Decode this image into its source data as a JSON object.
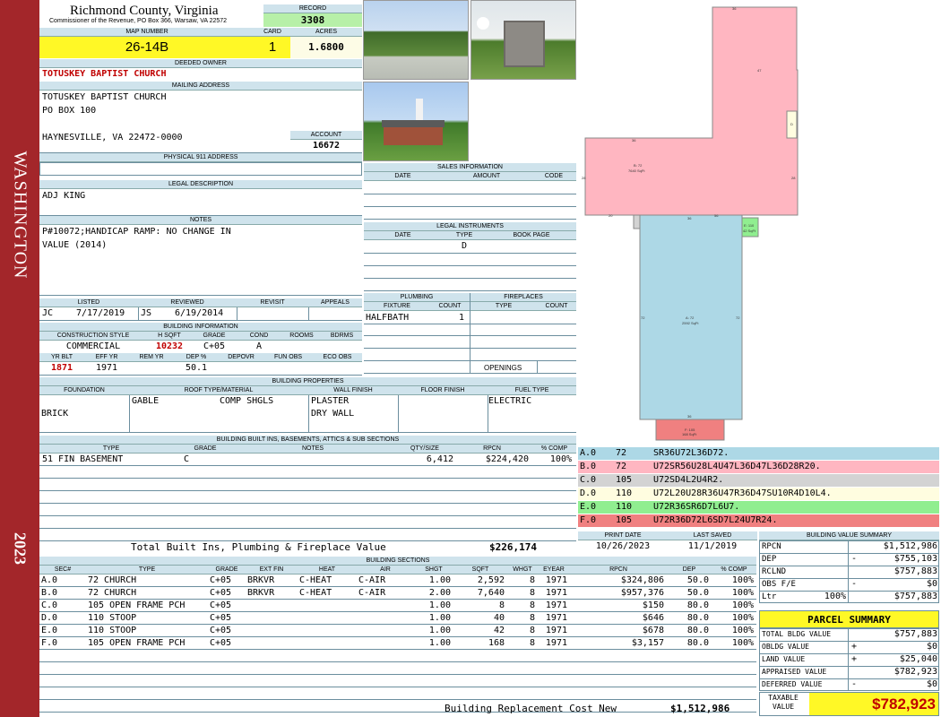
{
  "side": {
    "district": "WASHINGTON",
    "year": "2023"
  },
  "county": {
    "title": "Richmond County, Virginia",
    "subtitle": "Commissioner of the Revenue, PO Box 366, Warsaw, VA 22572"
  },
  "record": {
    "label": "RECORD",
    "value": "3308"
  },
  "map": {
    "label": "MAP NUMBER",
    "value": "26-14B"
  },
  "card": {
    "label": "CARD",
    "value": "1"
  },
  "acres": {
    "label": "ACRES",
    "value": "1.6800"
  },
  "owner": {
    "label": "DEEDED OWNER",
    "value": "TOTUSKEY BAPTIST CHURCH"
  },
  "mailing": {
    "label": "MAILING ADDRESS",
    "line1": "TOTUSKEY BAPTIST CHURCH",
    "line2": "PO BOX 100",
    "line3": "HAYNESVILLE, VA 22472-0000"
  },
  "account": {
    "label": "ACCOUNT",
    "value": "16672"
  },
  "physical": {
    "label": "PHYSICAL 911 ADDRESS"
  },
  "legal": {
    "label": "LEGAL DESCRIPTION",
    "value": "ADJ KING"
  },
  "notes": {
    "label": "NOTES",
    "line1": "P#10072;HANDICAP RAMP: NO CHANGE IN",
    "line2": "VALUE (2014)"
  },
  "listed": {
    "label": "LISTED",
    "by": "JC",
    "date": "7/17/2019"
  },
  "reviewed": {
    "label": "REVIEWED",
    "by": "JS",
    "date": "6/19/2014"
  },
  "revisit": {
    "label": "REVISIT"
  },
  "appeals": {
    "label": "APPEALS"
  },
  "bldginfo": {
    "label": "BUILDING INFORMATION",
    "h_style": "CONSTRUCTION STYLE",
    "h_sqft": "H SQFT",
    "h_grade": "GRADE",
    "h_cond": "COND",
    "h_rooms": "ROOMS",
    "h_bdrms": "BDRMS",
    "style": "COMMERCIAL",
    "sqft": "10232",
    "grade": "C+05",
    "cond": "A",
    "h_yrblt": "YR BLT",
    "h_effyr": "EFF YR",
    "h_remyr": "REM YR",
    "h_dep": "DEP %",
    "h_depovr": "DEPOVR",
    "h_funobs": "FUN OBS",
    "h_ecoobs": "ECO OBS",
    "yrblt": "1871",
    "effyr": "1971",
    "dep": "50.1"
  },
  "sales": {
    "label": "SALES INFORMATION",
    "h_date": "DATE",
    "h_amount": "AMOUNT",
    "h_code": "CODE"
  },
  "instruments": {
    "label": "LEGAL INSTRUMENTS",
    "h_date": "DATE",
    "h_type": "TYPE",
    "h_bookpage": "BOOK PAGE",
    "type1": "D"
  },
  "plumbing": {
    "label": "PLUMBING",
    "h_fixture": "FIXTURE",
    "h_count": "COUNT",
    "fixture": "HALFBATH",
    "count": "1"
  },
  "fireplaces": {
    "label": "FIREPLACES",
    "h_type": "TYPE",
    "h_count": "COUNT",
    "openings": "OPENINGS"
  },
  "bldgprops": {
    "label": "BUILDING PROPERTIES",
    "h_found": "FOUNDATION",
    "h_roof": "ROOF TYPE/MATERIAL",
    "h_wall": "WALL FINISH",
    "h_floor": "FLOOR FINISH",
    "h_fuel": "FUEL TYPE",
    "found": "BRICK",
    "roof1": "GABLE",
    "roof2": "COMP SHGLS",
    "wall1": "PLASTER",
    "wall2": "DRY WALL",
    "fuel": "ELECTRIC"
  },
  "builtins": {
    "label": "BUILDING BUILT INS, BASEMENTS, ATTICS & SUB SECTIONS",
    "h_type": "TYPE",
    "h_grade": "GRADE",
    "h_notes": "NOTES",
    "h_qty": "QTY/SIZE",
    "h_rpcn": "RPCN",
    "h_comp": "% COMP",
    "type": "51 FIN BASEMENT",
    "grade": "C",
    "qty": "6,412",
    "rpcn": "$224,420",
    "comp": "100%",
    "total_label": "Total Built Ins, Plumbing & Fireplace Value",
    "total_value": "$226,174"
  },
  "dates": {
    "print_label": "PRINT DATE",
    "print": "10/26/2023",
    "saved_label": "LAST SAVED",
    "saved": "11/1/2019"
  },
  "sections": {
    "label": "BUILDING SECTIONS",
    "headers": [
      "SEC#",
      "TYPE",
      "GRADE",
      "EXT FIN",
      "HEAT",
      "AIR",
      "SHGT",
      "SQFT",
      "WHGT",
      "EYEAR",
      "RPCN",
      "DEP",
      "% COMP"
    ],
    "rows": [
      [
        "A.0",
        "72 CHURCH",
        "C+05",
        "BRKVR",
        "C-HEAT",
        "C-AIR",
        "1.00",
        "2,592",
        "8",
        "1971",
        "$324,806",
        "50.0",
        "100%"
      ],
      [
        "B.0",
        "72 CHURCH",
        "C+05",
        "BRKVR",
        "C-HEAT",
        "C-AIR",
        "2.00",
        "7,640",
        "8",
        "1971",
        "$957,376",
        "50.0",
        "100%"
      ],
      [
        "C.0",
        "105 OPEN FRAME PCH",
        "C+05",
        "",
        "",
        "",
        "1.00",
        "8",
        "8",
        "1971",
        "$150",
        "80.0",
        "100%"
      ],
      [
        "D.0",
        "110 STOOP",
        "C+05",
        "",
        "",
        "",
        "1.00",
        "40",
        "8",
        "1971",
        "$646",
        "80.0",
        "100%"
      ],
      [
        "E.0",
        "110 STOOP",
        "C+05",
        "",
        "",
        "",
        "1.00",
        "42",
        "8",
        "1971",
        "$678",
        "80.0",
        "100%"
      ],
      [
        "F.0",
        "105 OPEN FRAME PCH",
        "C+05",
        "",
        "",
        "",
        "1.00",
        "168",
        "8",
        "1971",
        "$3,157",
        "80.0",
        "100%"
      ]
    ],
    "replacement_label": "Building Replacement Cost New",
    "replacement_value": "$1,512,986"
  },
  "legend": [
    {
      "sec": "A.0",
      "code": "72",
      "vector": "SR36U72L36D72.",
      "color": "#add8e6"
    },
    {
      "sec": "B.0",
      "code": "72",
      "vector": "U72SR56U28L4U47L36D47L36D28R20.",
      "color": "#ffb6c1"
    },
    {
      "sec": "C.0",
      "code": "105",
      "vector": "U72SD4L2U4R2.",
      "color": "#d3d3d3"
    },
    {
      "sec": "D.0",
      "code": "110",
      "vector": "U72L20U28R36U47R36D47SU10R4D10L4.",
      "color": "#fffde0"
    },
    {
      "sec": "E.0",
      "code": "110",
      "vector": "U72R36SR6D7L6U7.",
      "color": "#90ee90"
    },
    {
      "sec": "F.0",
      "code": "105",
      "vector": "U72R36D72L6SD7L24U7R24.",
      "color": "#f08080"
    }
  ],
  "sketch": {
    "b_label": "B: 72",
    "b_area": "7640 SqFt",
    "a_label": "A: 72",
    "a_area": "2592 SqFt",
    "e_label": "E: 110",
    "e_area": "42 SqFt",
    "f_label": "F: 105",
    "f_area": "168 SqFt",
    "d_label": "D",
    "dim36": "36",
    "dim47": "47",
    "dim28": "28",
    "dim20": "20",
    "dim72": "72",
    "dim24": "24",
    "dim56": "56"
  },
  "bvs": {
    "label": "BUILDING VALUE SUMMARY",
    "rpcn_l": "RPCN",
    "rpcn": "$1,512,986",
    "dep_l": "DEP",
    "dep_s": "-",
    "dep": "$755,103",
    "rclnd_l": "RCLND",
    "rclnd": "$757,883",
    "obs_l": "OBS F/E",
    "obs_s": "-",
    "obs": "$0",
    "ltr_l": "Ltr",
    "ltr_p": "100%",
    "ltr": "$757,883"
  },
  "ps": {
    "title": "PARCEL SUMMARY",
    "tbv_l": "TOTAL BLDG VALUE",
    "tbv": "$757,883",
    "obldg_l": "OBLDG VALUE",
    "obldg_s": "+",
    "obldg": "$0",
    "land_l": "LAND VALUE",
    "land_s": "+",
    "land": "$25,040",
    "appr_l": "APPRAISED VALUE",
    "appr": "$782,923",
    "def_l": "DEFERRED VALUE",
    "def_s": "-",
    "def": "$0",
    "tax_l1": "TAXABLE",
    "tax_l2": "VALUE",
    "tax": "$782,923"
  }
}
